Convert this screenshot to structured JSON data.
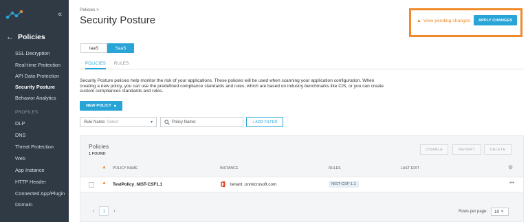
{
  "sidebar": {
    "back_title": "Policies",
    "items_top": [
      {
        "label": "SSL Decryption",
        "active": false
      },
      {
        "label": "Real-time Protection",
        "active": false
      },
      {
        "label": "API Data Protection",
        "active": false
      },
      {
        "label": "Security Posture",
        "active": true
      },
      {
        "label": "Behavior Analytics",
        "active": false
      }
    ],
    "section_label": "PROFILES",
    "items_profiles": [
      {
        "label": "DLP"
      },
      {
        "label": "DNS"
      },
      {
        "label": "Threat Protection"
      },
      {
        "label": "Web"
      },
      {
        "label": "App Instance"
      },
      {
        "label": "HTTP Header"
      },
      {
        "label": "Connected App/Plugin"
      },
      {
        "label": "Domain"
      }
    ],
    "colors": {
      "bg": "#2f3a45",
      "active": "#ffffff"
    }
  },
  "header": {
    "breadcrumb": "Policies >",
    "title": "Security Posture",
    "pending_text": "View pending changes",
    "apply_label": "APPLY CHANGES"
  },
  "toggle": {
    "left": "IaaS",
    "right": "SaaS",
    "selected": "SaaS"
  },
  "tabs": [
    {
      "label": "POLICIES",
      "active": true
    },
    {
      "label": "RULES",
      "active": false
    }
  ],
  "description": "Security Posture policies help monitor the risk of your applications. These policies will be used when scanning your application configuration. When creating a new policy, you can use the predefined compliance standards and rules, which are based on industry benchmarks like CIS, or you can create custom compliances standards and rules.",
  "new_policy_label": "NEW POLICY",
  "filters": {
    "rule_label": "Rule Name:",
    "rule_placeholder": "Select",
    "policy_label": "Policy Name:",
    "add_filter_label": "+ ADD FILTER"
  },
  "panel": {
    "title": "Policies",
    "count": "1 FOUND",
    "buttons": [
      "DISABLE",
      "REVERT",
      "DELETE"
    ],
    "columns": [
      "POLICY NAME",
      "INSTANCE",
      "RULES",
      "LAST EDIT"
    ],
    "rows": [
      {
        "policy": "TestPolicy_NIST-CSF1.1",
        "instance": "tenant .onmicrosoft.com",
        "rule": "NIST-CSF-1.1",
        "last_edit": "",
        "more": "•••"
      }
    ],
    "pager": {
      "prev": "‹",
      "page": "1",
      "next": "›"
    },
    "rows_per_page_label": "Rows per page:",
    "rows_per_page_value": "10"
  },
  "colors": {
    "accent": "#29a4d6",
    "warning": "#f0892a"
  }
}
